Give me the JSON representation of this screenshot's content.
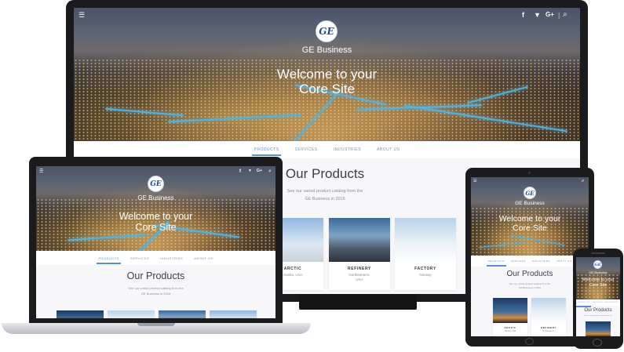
{
  "site": {
    "brand": "GE Business",
    "logo_text": "GE",
    "headline_line1": "Welcome to your",
    "headline_line2": "Core Site",
    "nav": [
      "PRODUCTS",
      "SERVICES",
      "INDUSTRIES",
      "ABOUT US"
    ],
    "section_title": "Our Products",
    "section_desc_line1": "See our varied product catalog from the",
    "section_desc_line2": "GE Business in 2016",
    "social_icons": [
      "menu-icon",
      "facebook-icon",
      "twitter-icon",
      "google-plus-icon",
      "search-icon"
    ],
    "icon_glyphs": {
      "menu": "☰",
      "facebook": "f",
      "twitter": "🐦",
      "gplus": "G+",
      "search": "⌕"
    }
  },
  "products": [
    {
      "name": "ARCTIC",
      "location": "Alaska, USA"
    },
    {
      "name": "REFINERY",
      "location_line1": "Northeastern,",
      "location_line2": "USA"
    },
    {
      "name": "FACTORY",
      "location": "Norway"
    }
  ],
  "colors": {
    "accent": "#5b8ed6",
    "streak": "#4fb6e6",
    "bezel": "#1b1b1d"
  }
}
